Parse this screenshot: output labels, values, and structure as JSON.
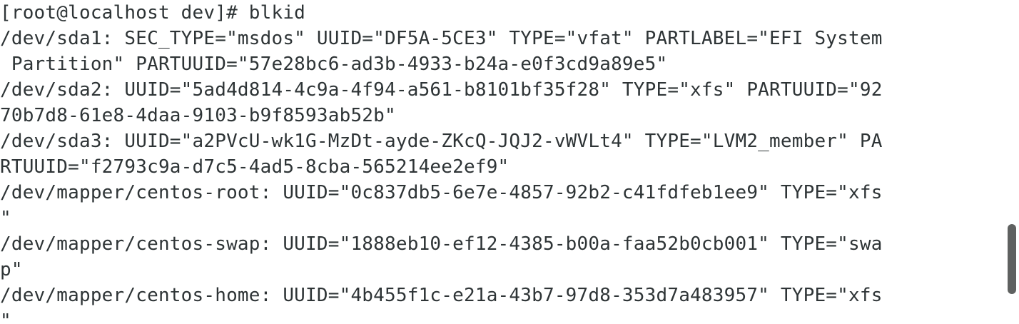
{
  "terminal": {
    "prompt_line": "[root@localhost dev]# blkid",
    "lines": [
      "/dev/sda1: SEC_TYPE=\"msdos\" UUID=\"DF5A-5CE3\" TYPE=\"vfat\" PARTLABEL=\"EFI System",
      " Partition\" PARTUUID=\"57e28bc6-ad3b-4933-b24a-e0f3cd9a89e5\"",
      "/dev/sda2: UUID=\"5ad4d814-4c9a-4f94-a561-b8101bf35f28\" TYPE=\"xfs\" PARTUUID=\"92",
      "70b7d8-61e8-4daa-9103-b9f8593ab52b\"",
      "/dev/sda3: UUID=\"a2PVcU-wk1G-MzDt-ayde-ZKcQ-JQJ2-vWVLt4\" TYPE=\"LVM2_member\" PA",
      "RTUUID=\"f2793c9a-d7c5-4ad5-8cba-565214ee2ef9\"",
      "/dev/mapper/centos-root: UUID=\"0c837db5-6e7e-4857-92b2-c41fdfeb1ee9\" TYPE=\"xfs",
      "\"",
      "/dev/mapper/centos-swap: UUID=\"1888eb10-ef12-4385-b00a-faa52b0cb001\" TYPE=\"swa",
      "p\"",
      "/dev/mapper/centos-home: UUID=\"4b455f1c-e21a-43b7-97d8-353d7a483957\" TYPE=\"xfs",
      "\""
    ]
  },
  "scrollbar": {
    "thumb_color": "#5f6160"
  }
}
